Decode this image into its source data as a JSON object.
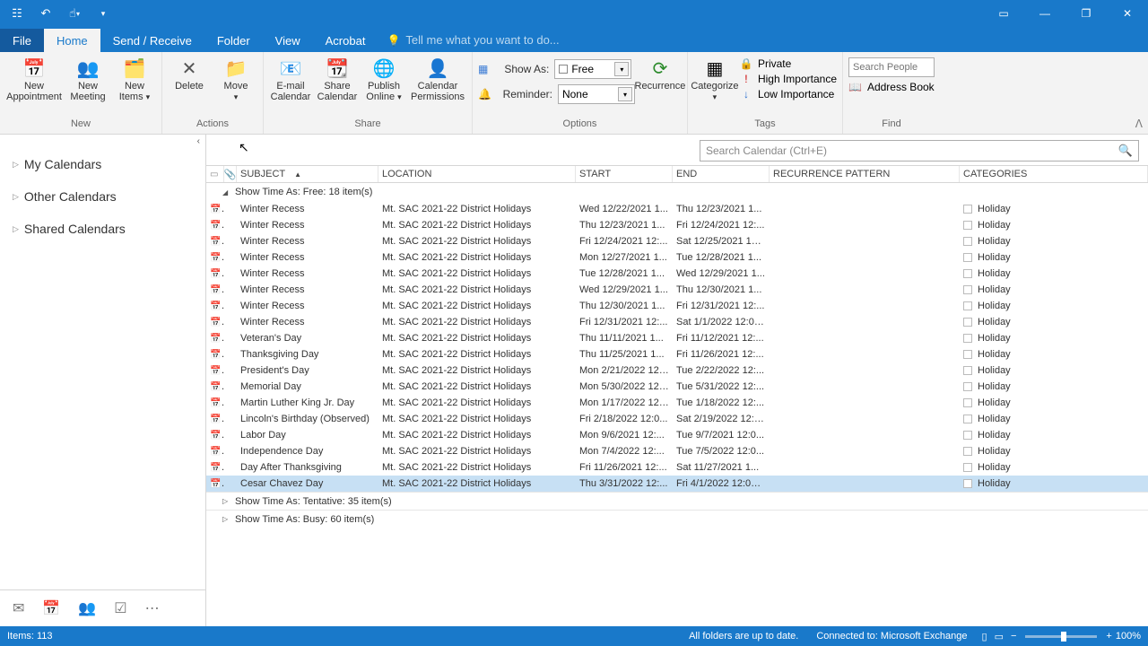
{
  "menutabs": {
    "file": "File",
    "home": "Home",
    "sendrecv": "Send / Receive",
    "folder": "Folder",
    "view": "View",
    "acrobat": "Acrobat",
    "tellme": "Tell me what you want to do..."
  },
  "ribbon": {
    "groups": {
      "new": "New",
      "actions": "Actions",
      "share": "Share",
      "options": "Options",
      "tags": "Tags",
      "find": "Find"
    },
    "new_appointment": "New Appointment",
    "new_meeting": "New Meeting",
    "new_items": "New Items",
    "delete": "Delete",
    "move": "Move",
    "email_cal": "E-mail Calendar",
    "share_cal": "Share Calendar",
    "publish": "Publish Online",
    "perms": "Calendar Permissions",
    "showas_label": "Show As:",
    "showas_value": "Free",
    "reminder_label": "Reminder:",
    "reminder_value": "None",
    "recurrence": "Recurrence",
    "categorize": "Categorize",
    "private": "Private",
    "high": "High Importance",
    "low": "Low Importance",
    "search_people_ph": "Search People",
    "address_book": "Address Book"
  },
  "nav": {
    "my": "My Calendars",
    "other": "Other Calendars",
    "shared": "Shared Calendars"
  },
  "search": {
    "placeholder": "Search Calendar (Ctrl+E)"
  },
  "columns": {
    "subject": "SUBJECT",
    "location": "LOCATION",
    "start": "START",
    "end": "END",
    "recurrence": "RECURRENCE PATTERN",
    "categories": "CATEGORIES"
  },
  "groups": {
    "free": "Show Time As: Free: 18 item(s)",
    "tentative": "Show Time As: Tentative: 35 item(s)",
    "busy": "Show Time As: Busy: 60 item(s)"
  },
  "events": [
    {
      "subject": "Winter Recess",
      "location": "Mt. SAC 2021-22 District Holidays",
      "start": "Wed 12/22/2021 1...",
      "end": "Thu 12/23/2021 1...",
      "category": "Holiday"
    },
    {
      "subject": "Winter Recess",
      "location": "Mt. SAC 2021-22 District Holidays",
      "start": "Thu 12/23/2021 1...",
      "end": "Fri 12/24/2021 12:...",
      "category": "Holiday"
    },
    {
      "subject": "Winter Recess",
      "location": "Mt. SAC 2021-22 District Holidays",
      "start": "Fri 12/24/2021 12:...",
      "end": "Sat 12/25/2021 12:...",
      "category": "Holiday"
    },
    {
      "subject": "Winter Recess",
      "location": "Mt. SAC 2021-22 District Holidays",
      "start": "Mon 12/27/2021 1...",
      "end": "Tue 12/28/2021 1...",
      "category": "Holiday"
    },
    {
      "subject": "Winter Recess",
      "location": "Mt. SAC 2021-22 District Holidays",
      "start": "Tue 12/28/2021 1...",
      "end": "Wed 12/29/2021 1...",
      "category": "Holiday"
    },
    {
      "subject": "Winter Recess",
      "location": "Mt. SAC 2021-22 District Holidays",
      "start": "Wed 12/29/2021 1...",
      "end": "Thu 12/30/2021 1...",
      "category": "Holiday"
    },
    {
      "subject": "Winter Recess",
      "location": "Mt. SAC 2021-22 District Holidays",
      "start": "Thu 12/30/2021 1...",
      "end": "Fri 12/31/2021 12:...",
      "category": "Holiday"
    },
    {
      "subject": "Winter Recess",
      "location": "Mt. SAC 2021-22 District Holidays",
      "start": "Fri 12/31/2021 12:...",
      "end": "Sat 1/1/2022 12:00...",
      "category": "Holiday"
    },
    {
      "subject": "Veteran's Day",
      "location": "Mt. SAC 2021-22 District Holidays",
      "start": "Thu 11/11/2021 1...",
      "end": "Fri 11/12/2021 12:...",
      "category": "Holiday"
    },
    {
      "subject": "Thanksgiving Day",
      "location": "Mt. SAC 2021-22 District Holidays",
      "start": "Thu 11/25/2021 1...",
      "end": "Fri 11/26/2021 12:...",
      "category": "Holiday"
    },
    {
      "subject": "President's Day",
      "location": "Mt. SAC 2021-22 District Holidays",
      "start": "Mon 2/21/2022 12:...",
      "end": "Tue 2/22/2022 12:...",
      "category": "Holiday"
    },
    {
      "subject": "Memorial Day",
      "location": "Mt. SAC 2021-22 District Holidays",
      "start": "Mon 5/30/2022 12:...",
      "end": "Tue 5/31/2022 12:...",
      "category": "Holiday"
    },
    {
      "subject": "Martin Luther King Jr. Day",
      "location": "Mt. SAC 2021-22 District Holidays",
      "start": "Mon 1/17/2022 12:...",
      "end": "Tue 1/18/2022 12:...",
      "category": "Holiday"
    },
    {
      "subject": "Lincoln's Birthday (Observed)",
      "location": "Mt. SAC 2021-22 District Holidays",
      "start": "Fri 2/18/2022 12:0...",
      "end": "Sat 2/19/2022 12:0...",
      "category": "Holiday"
    },
    {
      "subject": "Labor Day",
      "location": "Mt. SAC 2021-22 District Holidays",
      "start": "Mon 9/6/2021 12:...",
      "end": "Tue 9/7/2021 12:0...",
      "category": "Holiday"
    },
    {
      "subject": "Independence Day",
      "location": "Mt. SAC 2021-22 District Holidays",
      "start": "Mon 7/4/2022 12:...",
      "end": "Tue 7/5/2022 12:0...",
      "category": "Holiday"
    },
    {
      "subject": "Day After Thanksgiving",
      "location": "Mt. SAC 2021-22 District Holidays",
      "start": "Fri 11/26/2021 12:...",
      "end": "Sat 11/27/2021 1...",
      "category": "Holiday"
    },
    {
      "subject": "Cesar Chavez Day",
      "location": "Mt. SAC 2021-22 District Holidays",
      "start": "Thu 3/31/2022 12:...",
      "end": "Fri 4/1/2022 12:00 ...",
      "category": "Holiday"
    }
  ],
  "status": {
    "items": "Items: 113",
    "folders": "All folders are up to date.",
    "connected": "Connected to: Microsoft Exchange",
    "zoom": "100%"
  }
}
